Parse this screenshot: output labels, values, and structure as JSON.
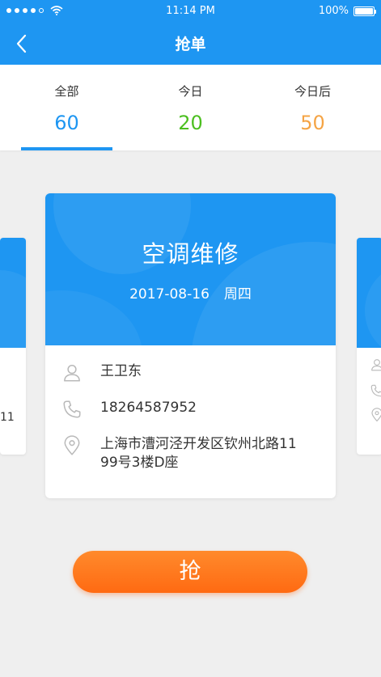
{
  "status_bar": {
    "time": "11:14 PM",
    "battery": "100%"
  },
  "nav": {
    "title": "抢单"
  },
  "tabs": [
    {
      "label": "全部",
      "count": "60",
      "color": "#1e96f2"
    },
    {
      "label": "今日",
      "count": "20",
      "color": "#4cbf20"
    },
    {
      "label": "今日后",
      "count": "50",
      "color": "#f5a445"
    }
  ],
  "card": {
    "service": "空调维修",
    "date": "2017-08-16",
    "weekday": "周四",
    "contact_name": "王卫东",
    "phone": "18264587952",
    "address_line1": "上海市漕河泾开发区钦州北路11",
    "address_line2": "99号3楼D座"
  },
  "left_card": {
    "partial_text": "11"
  },
  "action": {
    "grab_label": "抢"
  },
  "colors": {
    "primary": "#1e96f2",
    "accent": "#ff6f17",
    "background": "#efefef"
  }
}
